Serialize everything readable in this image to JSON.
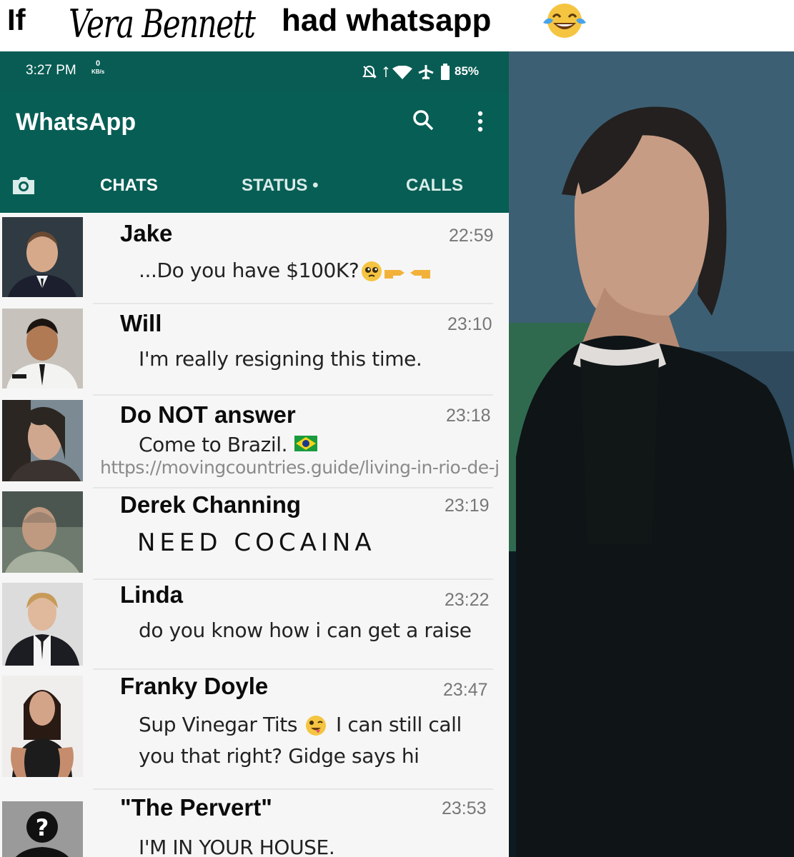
{
  "caption": {
    "prefix": "If",
    "name": "Vera Bennett",
    "suffix": "had whatsapp",
    "emoji": "tears-of-joy-emoji"
  },
  "status_bar": {
    "time": "3:27 PM",
    "data_rate_value": "0",
    "data_rate_unit": "KB/s",
    "icons": [
      "mute-icon",
      "signal-icon",
      "wifi-icon",
      "airplane-icon",
      "battery-icon"
    ],
    "battery": "85%"
  },
  "app": {
    "title": "WhatsApp",
    "tabs": [
      "CHATS",
      "STATUS •",
      "CALLS"
    ],
    "active_tab": "CHATS"
  },
  "chats": [
    {
      "name": "Jake",
      "time": "22:59",
      "message": "...Do you have $100K?",
      "emoji": "pleading-face-pointing-fingers"
    },
    {
      "name": "Will",
      "time": "23:10",
      "message": "I'm really resigning this time."
    },
    {
      "name": "Do NOT answer",
      "time": "23:18",
      "message": "Come to Brazil.",
      "emoji": "brazil-flag",
      "link": "https://movingcountries.guide/living-in-rio-de-j"
    },
    {
      "name": "Derek Channing",
      "time": "23:19",
      "message": "NEED COCAINA"
    },
    {
      "name": "Linda",
      "time": "23:22",
      "message": "do you know how i can get a raise"
    },
    {
      "name": "Franky Doyle",
      "time": "23:47",
      "message_line1": "Sup Vinegar Tits",
      "message_line1b": "I can still call",
      "message_line2": "you that right? Gidge says hi",
      "emoji": "winking-tongue-face"
    },
    {
      "name": "\"The Pervert\"",
      "time": "23:53",
      "message": "I'M IN YOUR HOUSE."
    }
  ],
  "colors": {
    "header": "#075e54",
    "status_bar": "#085c53",
    "tab_text": "#ffffff",
    "time_text": "#777777"
  }
}
